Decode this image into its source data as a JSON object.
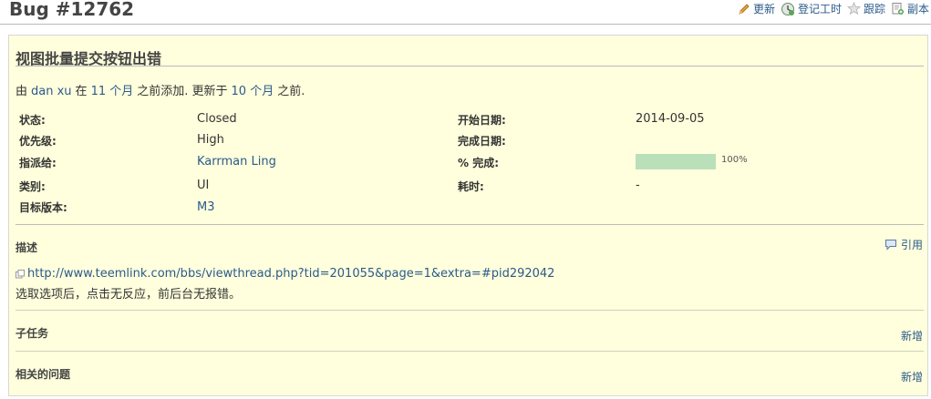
{
  "header": {
    "bug_title": "Bug #12762",
    "actions": {
      "edit": "更新",
      "log_time": "登记工时",
      "watch": "跟踪",
      "copy": "副本"
    }
  },
  "issue": {
    "subject": "视图批量提交按钮出错",
    "author_line": {
      "prefix": "由",
      "author": "dan xu",
      "mid1": "在",
      "added_ago": "11 个月",
      "mid2": "之前添加. 更新于",
      "updated_ago": "10 个月",
      "suffix": "之前."
    },
    "attributes": {
      "status_label": "状态:",
      "status_value": "Closed",
      "priority_label": "优先级:",
      "priority_value": "High",
      "assignee_label": "指派给:",
      "assignee_value": "Karrman Ling",
      "category_label": "类别:",
      "category_value": "UI",
      "target_label": "目标版本:",
      "target_value": "M3",
      "start_label": "开始日期:",
      "start_value": "2014-09-05",
      "due_label": "完成日期:",
      "due_value": "",
      "done_label": "% 完成:",
      "done_value": "100%",
      "done_fraction": 1.0,
      "spent_label": "耗时:",
      "spent_value": "-"
    },
    "description": {
      "title": "描述",
      "quote_label": "引用",
      "link": "http://www.teemlink.com/bbs/viewthread.php?tid=201055&page=1&extra=#pid292042",
      "text": "选取选项后，点击无反应，前后台无报错。"
    },
    "subtasks": {
      "title": "子任务",
      "add_label": "新增"
    },
    "relations": {
      "title": "相关的问题",
      "add_label": "新增"
    }
  },
  "colors": {
    "box_background": "#ffffdd",
    "link": "#2a5a8a",
    "progress_fill": "#bae0ba"
  }
}
